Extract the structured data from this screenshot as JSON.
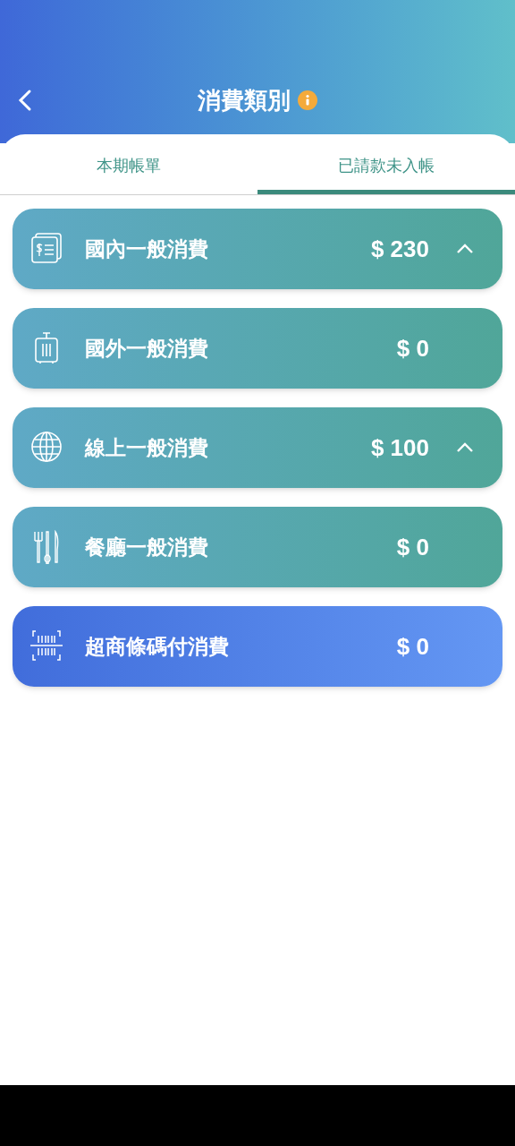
{
  "header": {
    "title": "消費類別"
  },
  "tabs": [
    {
      "label": "本期帳單",
      "selected": false
    },
    {
      "label": "已請款未入帳",
      "selected": true
    }
  ],
  "categories": [
    {
      "kind": "bill",
      "name": "國內一般消費",
      "amount": "$ 230",
      "expandable": true
    },
    {
      "kind": "luggage",
      "name": "國外一般消費",
      "amount": "$ 0",
      "expandable": false
    },
    {
      "kind": "globe",
      "name": "線上一般消費",
      "amount": "$ 100",
      "expandable": true
    },
    {
      "kind": "cutlery",
      "name": "餐廳一般消費",
      "amount": "$ 0",
      "expandable": false
    },
    {
      "kind": "barcode",
      "name": "超商條碼付消費",
      "amount": "$ 0",
      "expandable": false
    }
  ]
}
